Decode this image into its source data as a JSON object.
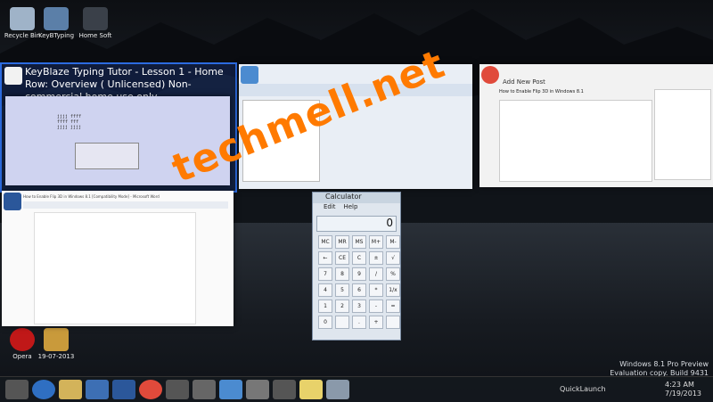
{
  "desktop": {
    "icons_top": [
      {
        "label": "Recycle Bin",
        "icon": "recycle-bin-icon"
      },
      {
        "label": "KeyBTyping",
        "icon": "keyblaze-icon"
      },
      {
        "label": "Home Soft",
        "icon": "folder-icon"
      }
    ],
    "icons_bottom": [
      {
        "label": "Opera",
        "icon": "opera-icon"
      },
      {
        "label": "19-07-2013",
        "icon": "folder-icon"
      }
    ]
  },
  "windows": {
    "keyblaze": {
      "title": "KeyBlaze Typing Tutor - Lesson 1 - Home Row: Overview ( Unlicensed) Non-commercial home use only",
      "sample_text": "jjjj ffff\nffff fff\njjjj jjjj\n"
    },
    "paint": {
      "title": ""
    },
    "chrome": {
      "title": "Add New Post",
      "post_title": "How to Enable Flip 3D in Windows 8.1"
    },
    "word": {
      "title": "How to Enable Flip 3D in Windows 8.1 [Compatibility Mode] - Microsoft Word"
    },
    "calculator": {
      "title": "Calculator",
      "menu": [
        "Edit",
        "Help"
      ],
      "display": "0",
      "keys": [
        "MC",
        "MR",
        "MS",
        "M+",
        "M-",
        "←",
        "CE",
        "C",
        "±",
        "√",
        "7",
        "8",
        "9",
        "/",
        "%",
        "4",
        "5",
        "6",
        "*",
        "1/x",
        "1",
        "2",
        "3",
        "-",
        "=",
        "0",
        "",
        ".",
        "+",
        ""
      ]
    }
  },
  "watermark": "techmell.net",
  "system": {
    "edition": "Windows 8.1 Pro Preview",
    "build": "Evaluation copy. Build 9431",
    "quicklaunch": "QuickLaunch",
    "time": "4:23 AM",
    "date": "7/19/2013"
  }
}
